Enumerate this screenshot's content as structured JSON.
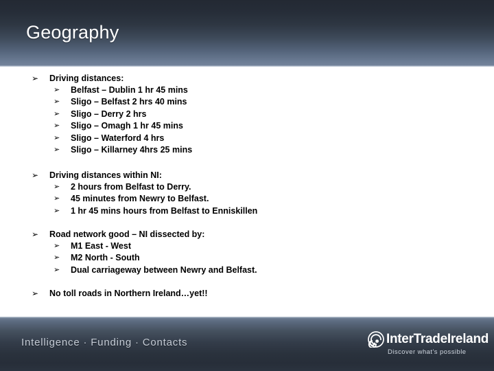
{
  "slide": {
    "title": "Geography"
  },
  "bullet_marker": "➢",
  "content": {
    "groups": [
      {
        "lead": "Driving distances:",
        "items": [
          "Belfast – Dublin 1 hr 45 mins",
          "Sligo – Belfast 2 hrs 40 mins",
          "Sligo – Derry 2 hrs",
          "Sligo – Omagh 1 hr 45 mins",
          "Sligo – Waterford 4 hrs",
          "Sligo – Killarney 4hrs 25 mins"
        ]
      },
      {
        "lead": "Driving distances within NI:",
        "items": [
          "2 hours from Belfast to Derry.",
          "45 minutes from Newry to Belfast.",
          "1 hr 45 mins hours from Belfast to Enniskillen"
        ]
      },
      {
        "lead": "Road network good – NI dissected by:",
        "items": [
          "M1  East - West",
          "M2  North - South",
          "Dual carriageway between Newry and Belfast."
        ]
      },
      {
        "lead": "No toll roads in Northern Ireland…yet!!",
        "items": []
      }
    ]
  },
  "footer": {
    "tagline": "Intelligence · Funding · Contacts",
    "logo": {
      "wordmark": "InterTradeIreland",
      "tagline": "Discover what's possible"
    }
  },
  "colors": {
    "header_top": "#232933",
    "header_bottom": "#73839a",
    "footer_top": "#74849a",
    "footer_bottom": "#2b333f",
    "body_background": "#ffffff",
    "title_text": "#ffffff",
    "bullet_text": "#000000",
    "footer_text": "#c5ccd6"
  }
}
